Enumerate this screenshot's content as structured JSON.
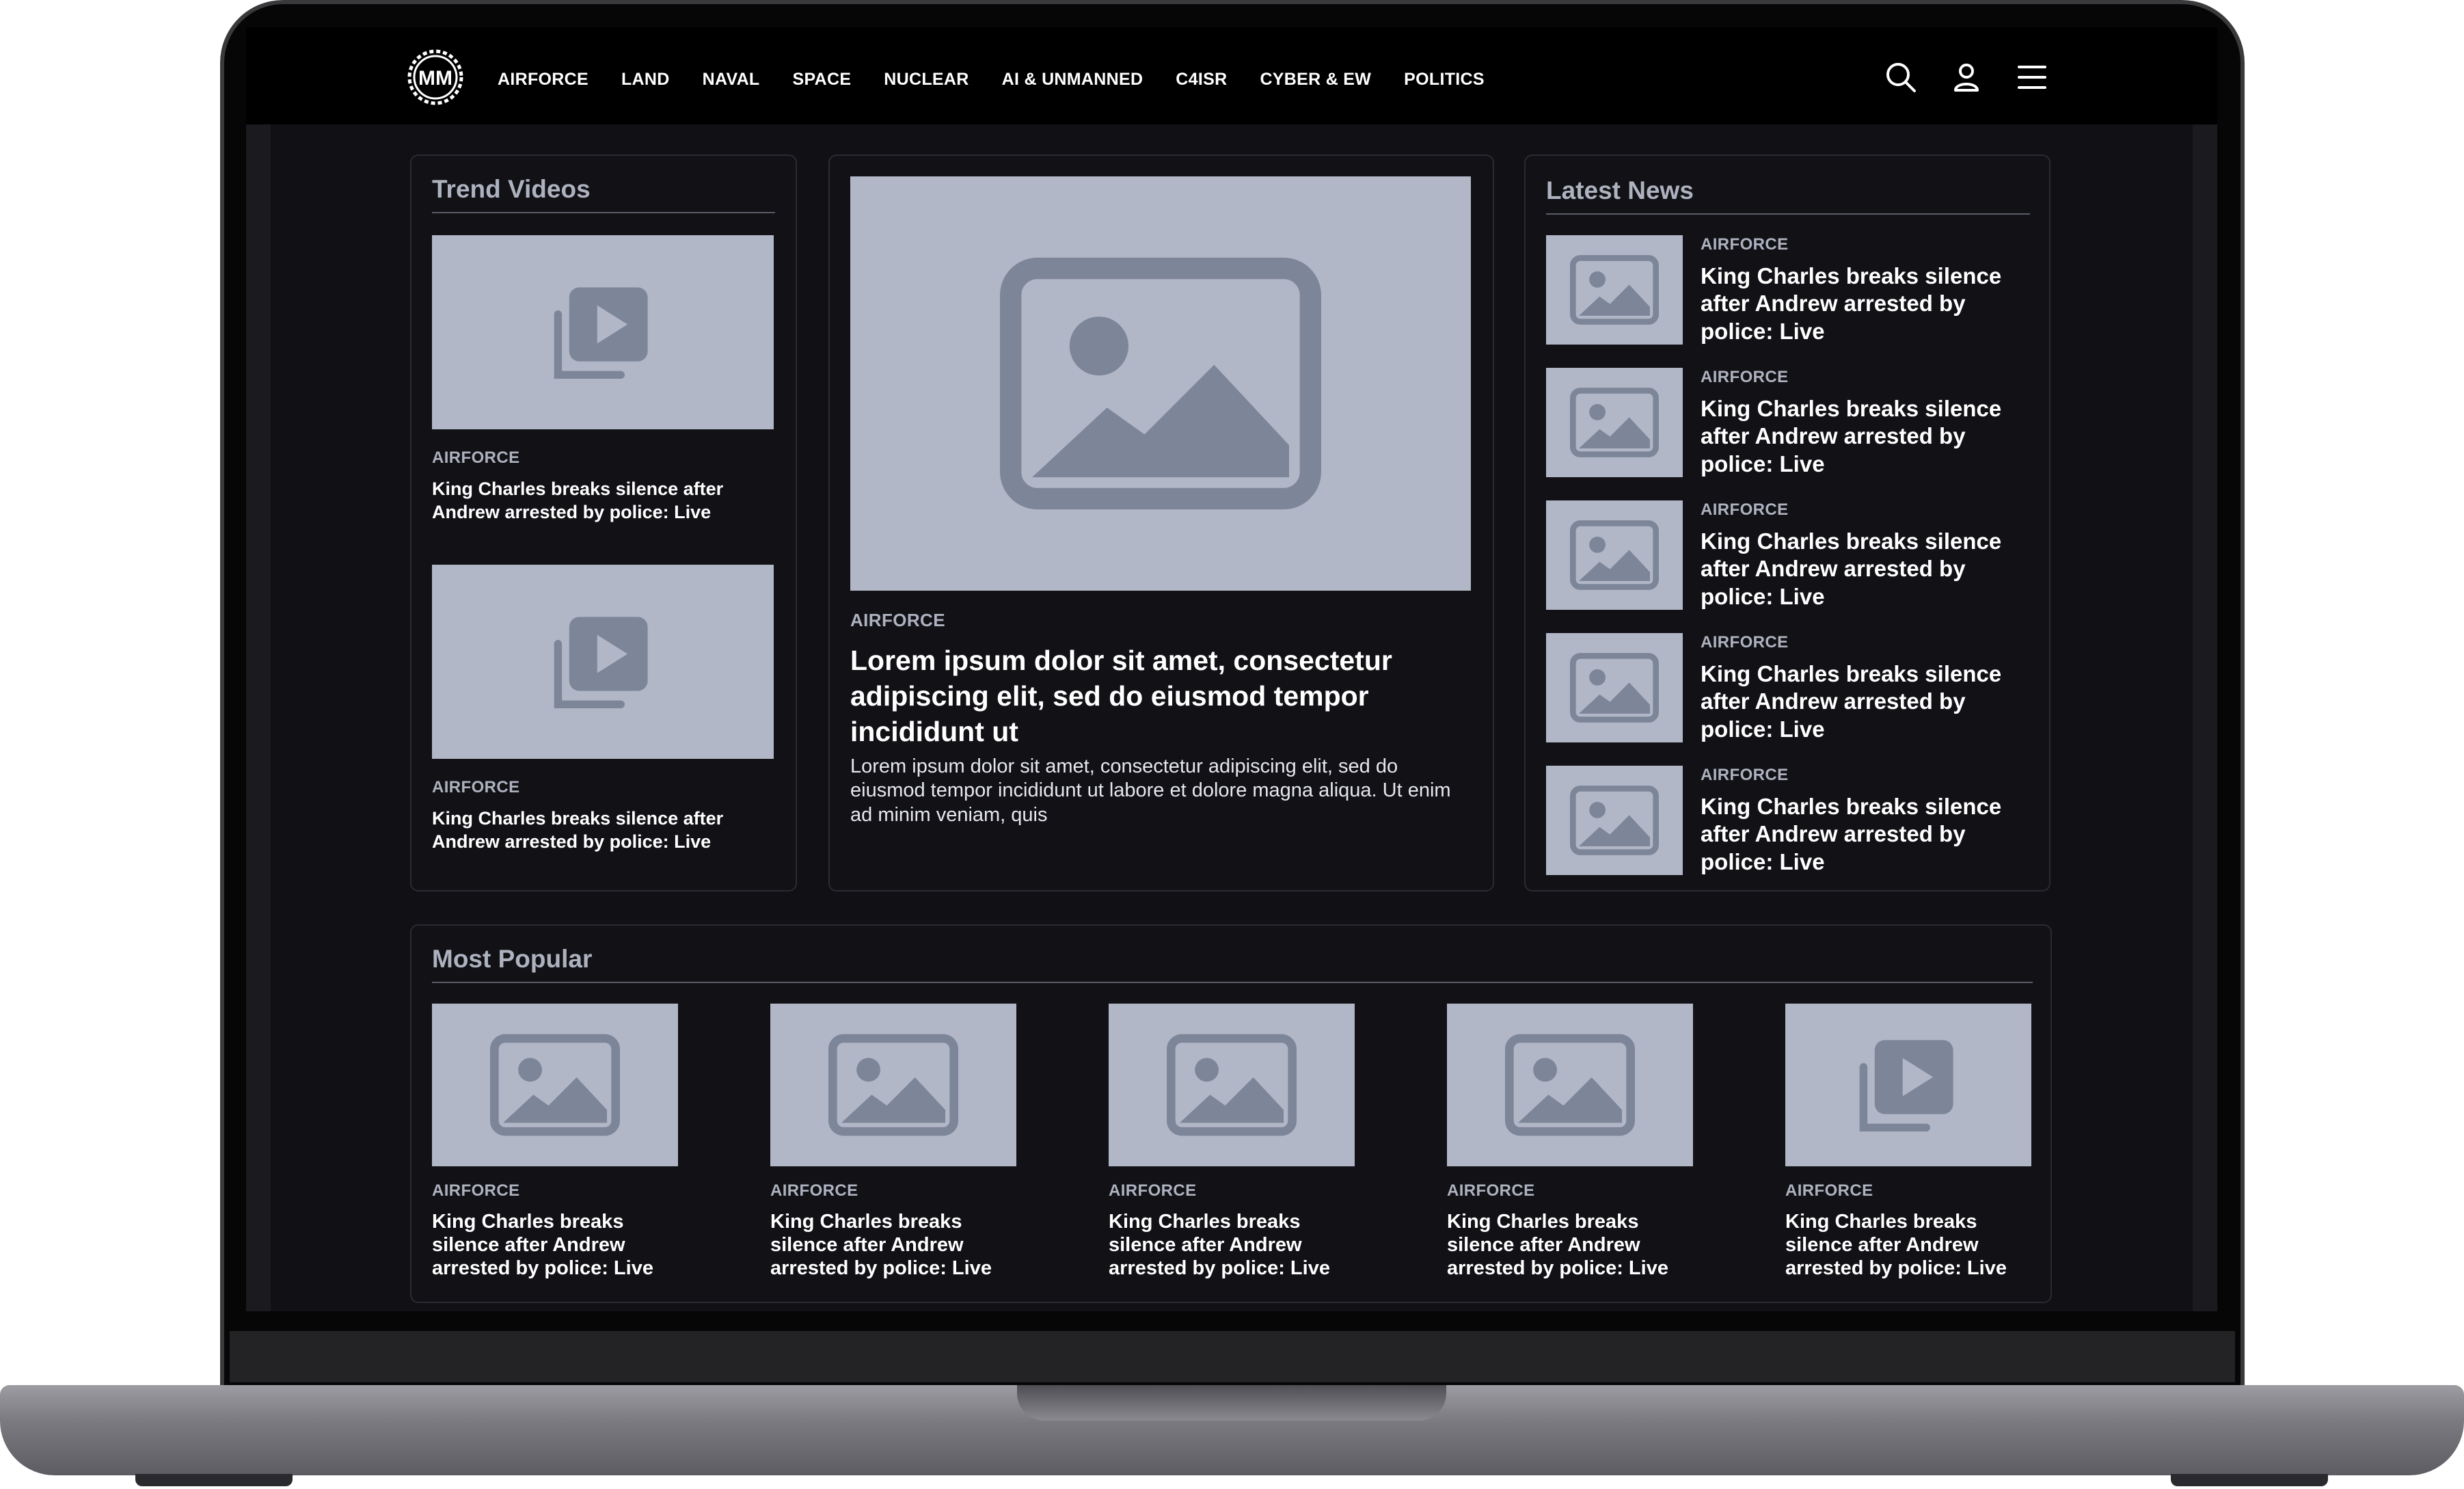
{
  "nav": {
    "logo_text": "MM",
    "links": [
      "AIRFORCE",
      "LAND",
      "NAVAL",
      "SPACE",
      "NUCLEAR",
      "AI & UNMANNED",
      "C4ISR",
      "CYBER & EW",
      "POLITICS"
    ],
    "icons": [
      "search-icon",
      "user-icon",
      "menu-icon"
    ]
  },
  "trend_videos": {
    "title": "Trend Videos",
    "items": [
      {
        "category": "AIRFORCE",
        "headline": "King Charles breaks silence after Andrew arrested by police: Live"
      },
      {
        "category": "AIRFORCE",
        "headline": "King Charles breaks silence after Andrew arrested by police: Live"
      }
    ]
  },
  "featured": {
    "category": "AIRFORCE",
    "headline": "Lorem ipsum dolor sit amet, consectetur adipiscing elit, sed do eiusmod tempor incididunt ut",
    "description": "Lorem ipsum dolor sit amet, consectetur adipiscing elit, sed do eiusmod tempor incididunt ut labore et dolore magna aliqua. Ut enim ad minim veniam, quis"
  },
  "latest_news": {
    "title": "Latest News",
    "items": [
      {
        "category": "AIRFORCE",
        "headline": "King Charles breaks silence after Andrew arrested by police: Live"
      },
      {
        "category": "AIRFORCE",
        "headline": "King Charles breaks silence after Andrew arrested by police: Live"
      },
      {
        "category": "AIRFORCE",
        "headline": "King Charles breaks silence after Andrew arrested by police: Live"
      },
      {
        "category": "AIRFORCE",
        "headline": "King Charles breaks silence after Andrew arrested by police: Live"
      },
      {
        "category": "AIRFORCE",
        "headline": "King Charles breaks silence after Andrew arrested by police: Live"
      }
    ]
  },
  "most_popular": {
    "title": "Most Popular",
    "items": [
      {
        "category": "AIRFORCE",
        "headline": "King Charles breaks silence after Andrew arrested by police: Live",
        "media": "image"
      },
      {
        "category": "AIRFORCE",
        "headline": "King Charles breaks silence after Andrew arrested by police: Live",
        "media": "image"
      },
      {
        "category": "AIRFORCE",
        "headline": "King Charles breaks silence after Andrew arrested by police: Live",
        "media": "image"
      },
      {
        "category": "AIRFORCE",
        "headline": "King Charles breaks silence after Andrew arrested by police: Live",
        "media": "image"
      },
      {
        "category": "AIRFORCE",
        "headline": "King Charles breaks silence after Andrew arrested by police: Live",
        "media": "video"
      }
    ]
  },
  "colors": {
    "placeholder_bg": "#b1b7c6",
    "placeholder_icon": "#7d8599",
    "card_bg": "#111116",
    "nav_bg": "#000000"
  }
}
